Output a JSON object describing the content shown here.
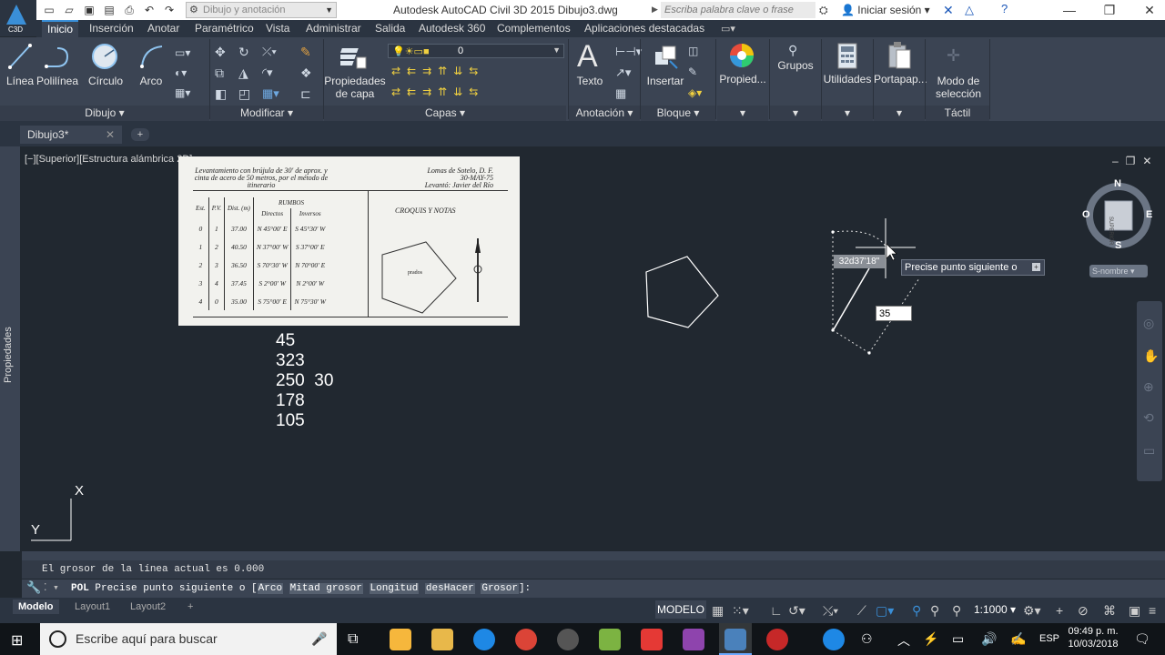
{
  "app": {
    "logo_label": "C3D",
    "title": "Autodesk AutoCAD Civil 3D 2015    Dibujo3.dwg",
    "workspace_placeholder": "Dibujo y anotación",
    "search_placeholder": "Escriba palabra clave o frase",
    "signin": "Iniciar sesión"
  },
  "ribbon_tabs": [
    "Inicio",
    "Inserción",
    "Anotar",
    "Paramétrico",
    "Vista",
    "Administrar",
    "Salida",
    "Autodesk 360",
    "Complementos",
    "Aplicaciones destacadas"
  ],
  "ribbon": {
    "draw": {
      "linea": "Línea",
      "polilinea": "Polilínea",
      "circulo": "Círculo",
      "arco": "Arco",
      "panel": "Dibujo"
    },
    "modify": {
      "panel": "Modificar"
    },
    "layers": {
      "props": "Propiedades de capa",
      "layer_value": "0",
      "panel": "Capas"
    },
    "annotation": {
      "texto": "Texto",
      "panel": "Anotación"
    },
    "block": {
      "insertar": "Insertar",
      "panel": "Bloque"
    },
    "propied": "Propied...",
    "grupos": "Grupos",
    "utilidades": "Utilidades",
    "portapap": "Portapap...",
    "modo": "Modo de selección",
    "tactil": "Táctil"
  },
  "doc_tab": "Dibujo3*",
  "viewport_label": "[−][Superior][Estructura alámbrica 2D]",
  "side_panel_label": "Propiedades",
  "scan": {
    "header_left": "Levantamiento con brújula de 30' de aprox. y cinta de acero de 50 metros, por el método de itinerario",
    "header_right": "Lomas de Sotelo, D. F.\n30-MAY-75\nLevantó: Javier del Río",
    "col_est": "Est.",
    "col_pv": "P.V.",
    "col_dist": "Dist. (m)",
    "col_rumbos": "RUMBOS",
    "col_directos": "Directos",
    "col_inversos": "Inversos",
    "col_croquis": "CROQUIS Y NOTAS",
    "croquis_label": "prados",
    "rows": [
      {
        "est": "0",
        "pv": "1",
        "dist": "37.00",
        "dir": "N 45°00' E",
        "inv": "S 45°30' W"
      },
      {
        "est": "1",
        "pv": "2",
        "dist": "40.50",
        "dir": "N 37°00' W",
        "inv": "S 37°00' E"
      },
      {
        "est": "2",
        "pv": "3",
        "dist": "36.50",
        "dir": "S 70°30' W",
        "inv": "N 70°00' E"
      },
      {
        "est": "3",
        "pv": "4",
        "dist": "37.45",
        "dir": "S 2°00' W",
        "inv": "N 2°00' W"
      },
      {
        "est": "4",
        "pv": "0",
        "dist": "35.00",
        "dir": "S 75°00' E",
        "inv": "N 75°30' W"
      }
    ]
  },
  "drawing_text": [
    "45",
    "323",
    "250  30",
    "178",
    "105"
  ],
  "dynamic_input": {
    "angle": "32d37'18\"",
    "distance": "35",
    "tooltip": "Precise punto siguiente o"
  },
  "viewcube": {
    "n": "N",
    "s": "S",
    "e": "E",
    "o": "O",
    "face": "SUPERIOR",
    "wcs": "S-nombre"
  },
  "ucs": {
    "x": "X",
    "y": "Y"
  },
  "command": {
    "history": "El grosor de la línea actual es 0.000",
    "prefix": "POL",
    "prompt": "Precise punto siguiente o [",
    "options": [
      "Arco",
      "Mitad grosor",
      "Longitud",
      "desHacer",
      "Grosor"
    ],
    "suffix": "]:"
  },
  "layout_tabs": [
    "Modelo",
    "Layout1",
    "Layout2"
  ],
  "status": {
    "modelo": "MODELO",
    "scale": "1:1000"
  },
  "taskbar": {
    "search": "Escribe aquí para buscar",
    "lang": "ESP",
    "time": "09:49 p. m.",
    "date": "10/03/2018"
  }
}
